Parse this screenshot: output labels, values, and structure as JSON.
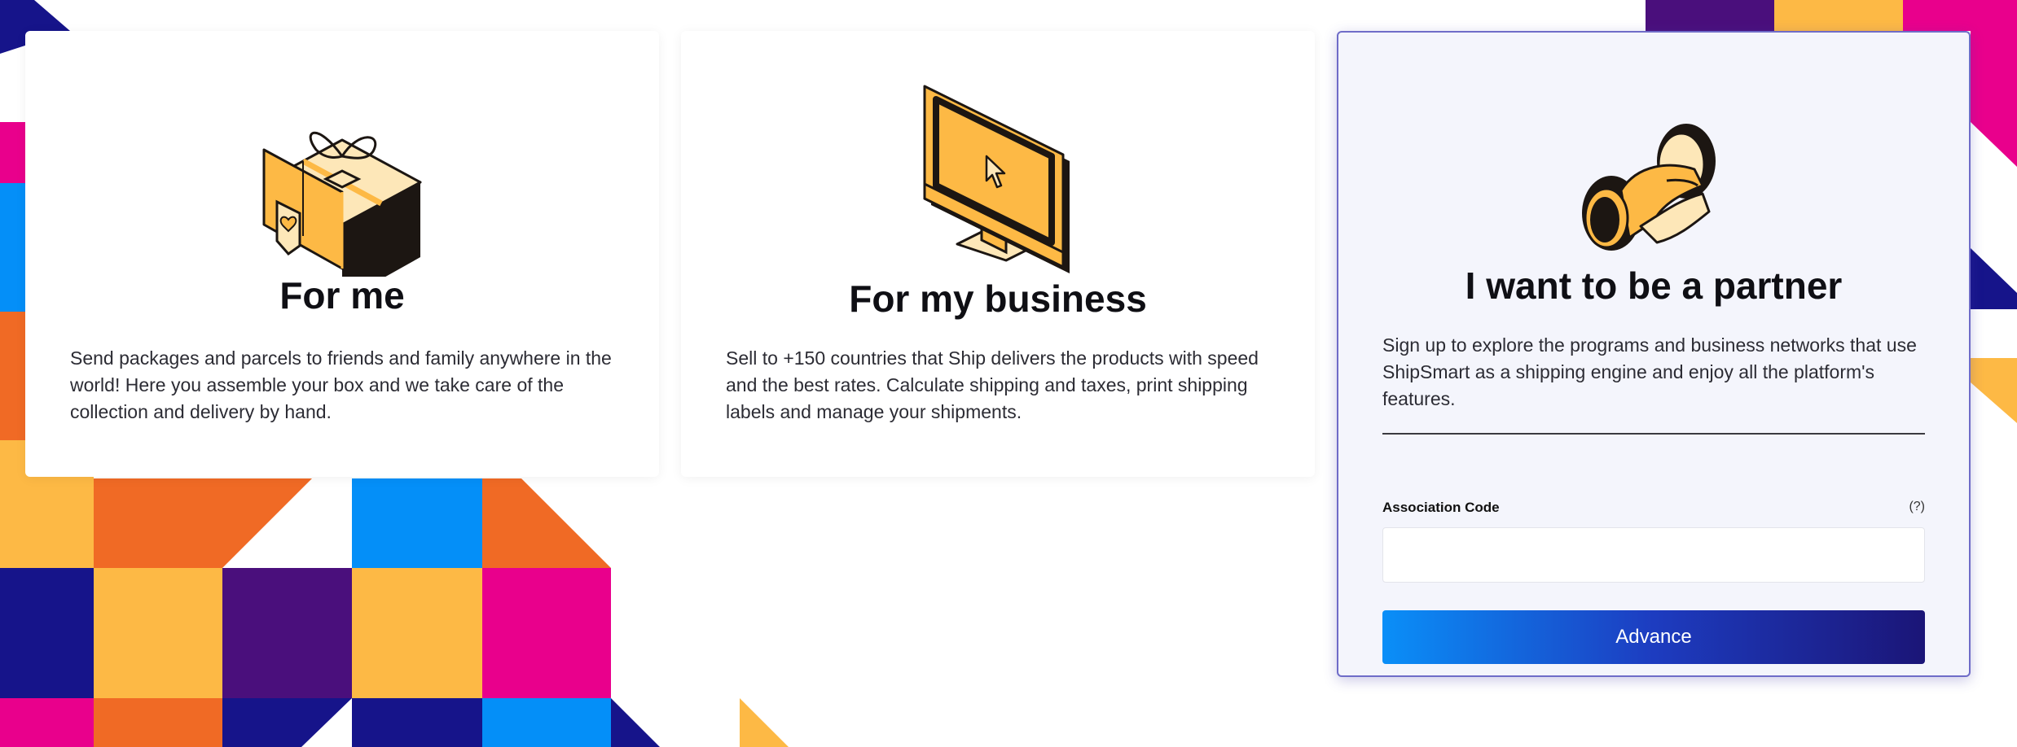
{
  "cards": {
    "personal": {
      "title": "For me",
      "description": "Send packages and parcels to friends and family anywhere in the world! Here you assemble your box and we take care of the collection and delivery by hand.",
      "icon": "gift-box-icon"
    },
    "business": {
      "title": "For my business",
      "description": "Sell to +150 countries that Ship delivers the products with speed and the best rates. Calculate shipping and taxes, print shipping labels and manage your shipments.",
      "icon": "monitor-cursor-icon"
    },
    "partner": {
      "title": "I want to be a partner",
      "description": "Sign up to explore the programs and business networks that use ShipSmart as a shipping engine and enjoy all the platform's features.",
      "icon": "handshake-icon",
      "field_label": "Association Code",
      "help_text": "(?)",
      "input_value": "",
      "button_label": "Advance"
    }
  },
  "colors": {
    "yellow": "#fdb945",
    "orange": "#f06a25",
    "blue": "#048ff8",
    "navy": "#16148a",
    "purple": "#4a0f7c",
    "pink": "#e9008c",
    "partner_border": "#6f6cc8"
  }
}
